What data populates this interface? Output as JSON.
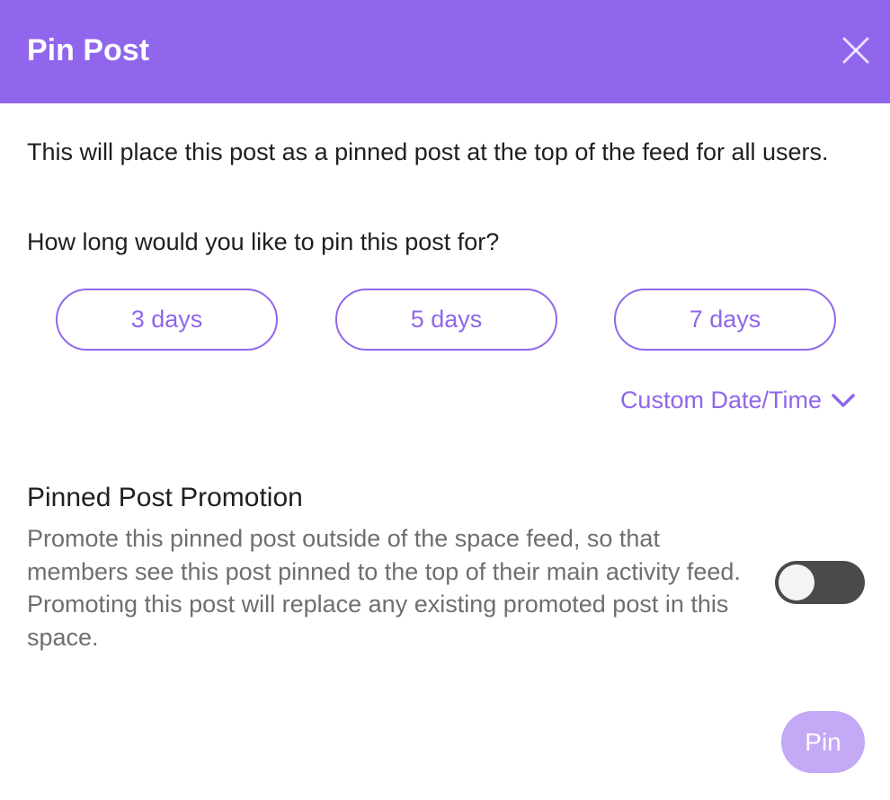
{
  "dialog": {
    "title": "Pin Post",
    "close_icon": "close-icon",
    "description": "This will place this post as a pinned post at the top of the feed for all users.",
    "question": "How long would you like to pin this post for?",
    "durations": [
      {
        "label": "3 days"
      },
      {
        "label": "5 days"
      },
      {
        "label": "7 days"
      }
    ],
    "custom_label": "Custom Date/Time",
    "custom_icon": "chevron-down-icon",
    "promotion": {
      "title": "Pinned Post Promotion",
      "description": "Promote this pinned post outside of the space feed, so that members see this post pinned to the top of their main activity feed. Promoting this post will replace any existing promoted post in this space.",
      "toggle_on": false
    },
    "pin_label": "Pin"
  },
  "colors": {
    "accent": "#9066ec",
    "pin_disabled": "#c3a9f6",
    "toggle_off": "#4a4a4a"
  }
}
